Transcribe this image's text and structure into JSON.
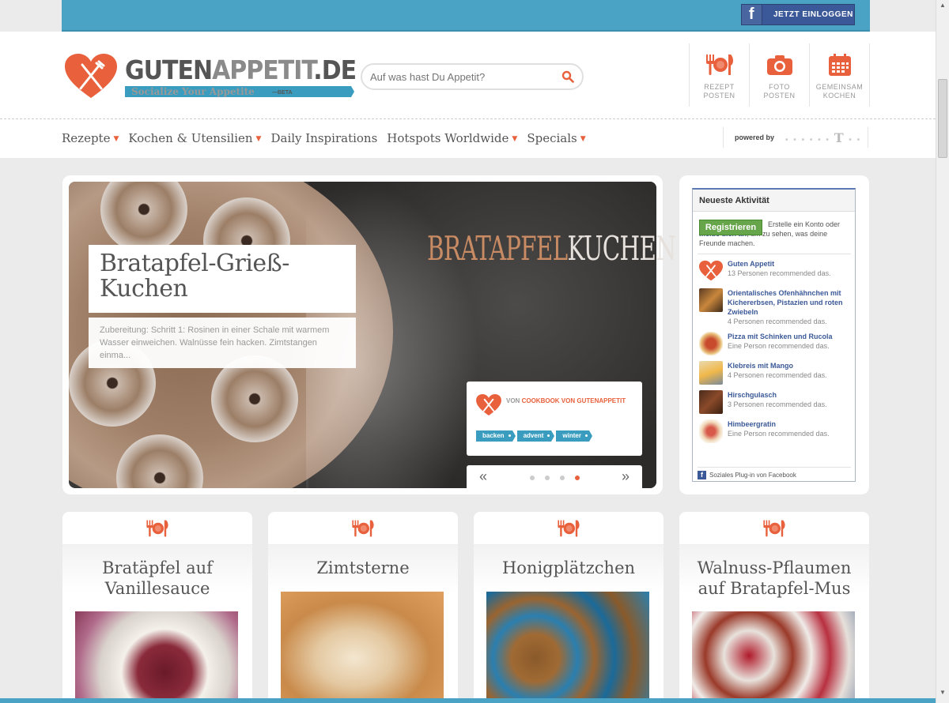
{
  "topbar": {
    "login_label": "JETZT EINLOGGEN",
    "fb_letter": "f"
  },
  "logo": {
    "name_a": "GUTEN",
    "name_b": "APPETIT",
    "name_c": ".DE",
    "tagline": "Socialize Your Appetite",
    "beta": "—BETA"
  },
  "search": {
    "placeholder": "Auf was hast Du Appetit?"
  },
  "actions": [
    {
      "label": "REZEPT\nPOSTEN",
      "icon": "cutlery-icon"
    },
    {
      "label": "FOTO\nPOSTEN",
      "icon": "camera-icon"
    },
    {
      "label": "GEMEINSAM\nKOCHEN",
      "icon": "calendar-icon"
    }
  ],
  "nav": [
    "Rezepte",
    "Kochen & Utensilien",
    "Daily Inspirations",
    "Hotspots Worldwide",
    "Specials"
  ],
  "nav_caret": "▼",
  "powered": {
    "label": "powered by",
    "brand": "T"
  },
  "hero": {
    "art_a": "BRATAPFEL",
    "art_b": "KUCHEN",
    "title": "Bratapfel-Grieß-Kuchen",
    "excerpt": "Zubereitung: Schritt 1: Rosinen in einer Schale mit warmem Wasser einweichen. Walnüsse fein hacken. Zimtstangen einma...",
    "by_prefix": "VON",
    "by_author": "COOKBOOK VON GUTENAPPETIT",
    "tags": [
      "backen",
      "advent",
      "winter"
    ],
    "prev": "«",
    "next": "»",
    "active_slide": 4
  },
  "activity": {
    "heading": "Neueste Aktivität",
    "register": "Registrieren",
    "register_text_a": "Erstelle ein Konto oder ",
    "register_link": "melde dich an",
    "register_text_b": ", um zu sehen, was deine Freunde machen.",
    "items": [
      {
        "title": "Guten Appetit",
        "count": "13 Personen recommended das."
      },
      {
        "title": "Orientalisches Ofenhähnchen mit Kichererbsen, Pistazien und roten Zwiebeln",
        "count": "4 Personen recommended das."
      },
      {
        "title": "Pizza mit Schinken und Rucola",
        "count": "Eine Person recommended das."
      },
      {
        "title": "Klebreis mit Mango",
        "count": "4 Personen recommended das."
      },
      {
        "title": "Hirschgulasch",
        "count": "3 Personen recommended das."
      },
      {
        "title": "Himbeergratin",
        "count": "Eine Person recommended das."
      }
    ],
    "footer": "Soziales Plug-in von Facebook",
    "footer_f": "f"
  },
  "cards": [
    {
      "title": "Bratäpfel auf Vanillesauce"
    },
    {
      "title": "Zimtsterne"
    },
    {
      "title": "Honigplätzchen"
    },
    {
      "title": "Walnuss-Pflaumen auf Bratapfel-Mus"
    }
  ],
  "colors": {
    "accent": "#e8603c",
    "topbar": "#4aa3c4",
    "facebook": "#3b5998"
  }
}
